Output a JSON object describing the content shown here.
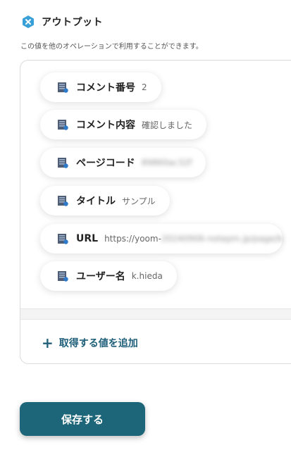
{
  "header": {
    "title": "アウトプット",
    "description": "この値を他のオペレーションで利用することができます。",
    "icon": "close-x-hex-icon",
    "icon_color": "#3aa0d8"
  },
  "outputs": [
    {
      "label": "コメント番号",
      "value": "2",
      "icon": "database-icon"
    },
    {
      "label": "コメント内容",
      "value": "確認しました",
      "icon": "database-icon"
    },
    {
      "label": "ページコード",
      "value": "89860ac32f",
      "icon": "database-icon",
      "blurred": true
    },
    {
      "label": "タイトル",
      "value": "サンプル",
      "icon": "database-icon"
    },
    {
      "label": "URL",
      "value": "https://yoom-20240906-notepm.jp/page/b",
      "icon": "database-icon",
      "partially_blurred": true
    },
    {
      "label": "ユーザー名",
      "value": "k.hieda",
      "icon": "database-icon"
    }
  ],
  "add_field": {
    "label": "取得する値を追加",
    "icon": "plus-icon"
  },
  "save_button": {
    "label": "保存する",
    "color": "#1d6578"
  }
}
